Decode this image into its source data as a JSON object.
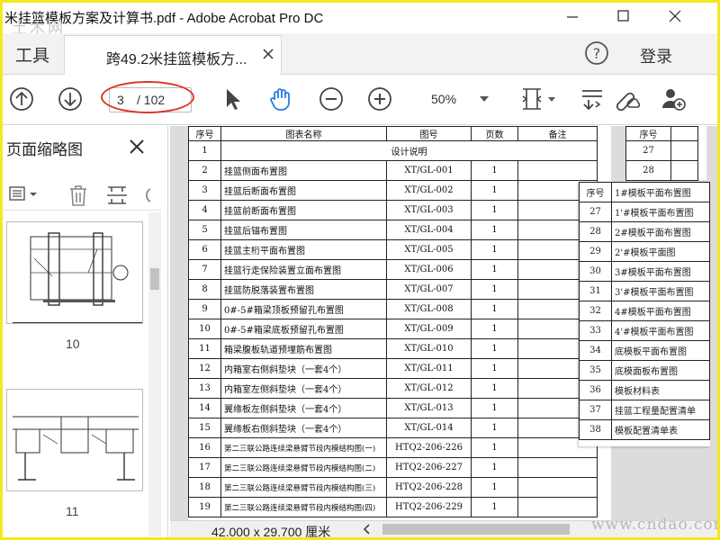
{
  "window": {
    "title": "米挂篮模板方案及计算书.pdf - Adobe Acrobat Pro DC",
    "watermark_top": "土木网",
    "watermark_bottom": "www.cndao.com"
  },
  "tabs": {
    "tools_label": "工具",
    "doc_label": "跨49.2米挂篮模板方...",
    "login_label": "登录"
  },
  "toolbar": {
    "page_current": "3",
    "page_total": "/ 102",
    "zoom_value": "50%"
  },
  "left_panel": {
    "title": "页面缩略图",
    "thumbnails": [
      {
        "page_number": "10"
      },
      {
        "page_number": "11"
      }
    ]
  },
  "status": {
    "page_size": "42.000 x 29.700 厘米"
  },
  "document": {
    "headers": [
      "序号",
      "图表名称",
      "图号",
      "页数",
      "备注"
    ],
    "rows": [
      {
        "no": "1",
        "name": "设计说明",
        "code": "",
        "pages": ""
      },
      {
        "no": "2",
        "name": "挂篮侧面布置图",
        "code": "XT/GL-001",
        "pages": "1"
      },
      {
        "no": "3",
        "name": "挂篮后断面布置图",
        "code": "XT/GL-002",
        "pages": "1"
      },
      {
        "no": "4",
        "name": "挂篮前断面布置图",
        "code": "XT/GL-003",
        "pages": "1"
      },
      {
        "no": "5",
        "name": "挂篮后锚布置图",
        "code": "XT/GL-004",
        "pages": "1"
      },
      {
        "no": "6",
        "name": "挂篮主桁平面布置图",
        "code": "XT/GL-005",
        "pages": "1"
      },
      {
        "no": "7",
        "name": "挂篮行走保险装置立面布置图",
        "code": "XT/GL-006",
        "pages": "1"
      },
      {
        "no": "8",
        "name": "挂篮防脱落装置布置图",
        "code": "XT/GL-007",
        "pages": "1"
      },
      {
        "no": "9",
        "name": "0#-5#箱梁顶板预留孔布置图",
        "code": "XT/GL-008",
        "pages": "1"
      },
      {
        "no": "10",
        "name": "0#-5#箱梁底板预留孔布置图",
        "code": "XT/GL-009",
        "pages": "1"
      },
      {
        "no": "11",
        "name": "箱梁腹板轨道预埋筋布置图",
        "code": "XT/GL-010",
        "pages": "1"
      },
      {
        "no": "12",
        "name": "内箱室右侧斜垫块（一套4个）",
        "code": "XT/GL-011",
        "pages": "1"
      },
      {
        "no": "13",
        "name": "内箱室左侧斜垫块（一套4个）",
        "code": "XT/GL-012",
        "pages": "1"
      },
      {
        "no": "14",
        "name": "翼缘板左侧斜垫块（一套4个）",
        "code": "XT/GL-013",
        "pages": "1"
      },
      {
        "no": "15",
        "name": "翼缘板右侧斜垫块（一套4个）",
        "code": "XT/GL-014",
        "pages": "1"
      },
      {
        "no": "16",
        "name": "第二三联公路连续梁悬臂节段内模结构图(一)",
        "code": "HTQ2-206-226",
        "pages": "1"
      },
      {
        "no": "17",
        "name": "第二三联公路连续梁悬臂节段内模结构图(二)",
        "code": "HTQ2-206-227",
        "pages": "1"
      },
      {
        "no": "18",
        "name": "第二三联公路连续梁悬臂节段内模结构图(三)",
        "code": "HTQ2-206-228",
        "pages": "1"
      },
      {
        "no": "19",
        "name": "第二三联公路连续梁悬臂节段内模结构图(四)",
        "code": "HTQ2-206-229",
        "pages": "1"
      }
    ],
    "page2_header": "序号",
    "page2_rows": [
      "27",
      "28"
    ],
    "overlay_rows": [
      {
        "no": "序号",
        "name": "1#模板平面布置图"
      },
      {
        "no": "27",
        "name": "1'#模板平面布置图"
      },
      {
        "no": "28",
        "name": "2#模板平面布置图"
      },
      {
        "no": "29",
        "name": "2'#模板平面图"
      },
      {
        "no": "30",
        "name": "3#模板平面布置图"
      },
      {
        "no": "31",
        "name": "3'#模板平面布置图"
      },
      {
        "no": "32",
        "name": "4#模板平面布置图"
      },
      {
        "no": "33",
        "name": "4'#模板平面布置图"
      },
      {
        "no": "34",
        "name": "底模板平面布置图"
      },
      {
        "no": "35",
        "name": "底模面板布置图"
      },
      {
        "no": "36",
        "name": "模板材料表"
      },
      {
        "no": "37",
        "name": "挂篮工程量配置清单"
      },
      {
        "no": "38",
        "name": "模板配置清单表"
      }
    ]
  },
  "colors": {
    "frame": "#f4e81c",
    "annotation_oval": "#e0312a",
    "hand_tool_active": "#2a7ce0"
  },
  "icons": [
    "arrow-up-circle-icon",
    "arrow-down-circle-icon",
    "pointer-icon",
    "hand-icon",
    "zoom-out-icon",
    "zoom-in-icon",
    "fit-page-icon",
    "scroll-mode-icon",
    "link-cloud-icon",
    "add-user-icon",
    "help-icon",
    "close-icon",
    "list-options-icon",
    "trash-icon",
    "extract-page-icon"
  ]
}
